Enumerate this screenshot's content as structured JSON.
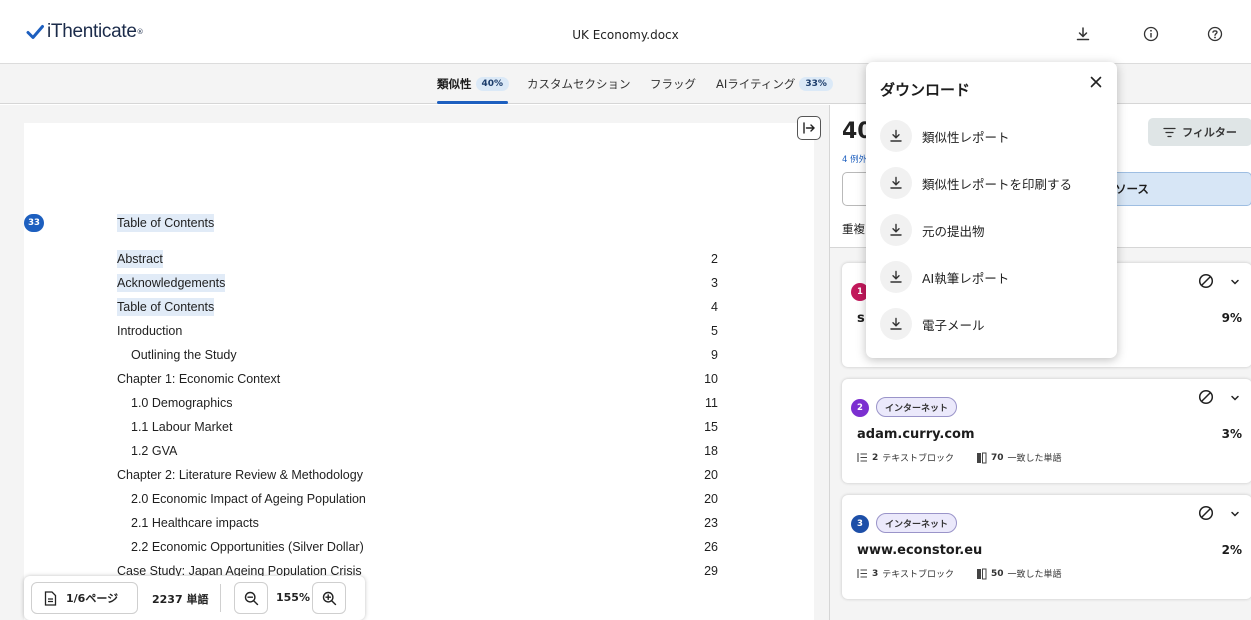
{
  "app": {
    "logo_text": "iThenticate",
    "logo_mark": "®",
    "document_title": "UK Economy.docx"
  },
  "tabs": [
    {
      "label": "類似性",
      "badge": "40%"
    },
    {
      "label": "カスタムセクション"
    },
    {
      "label": "フラッグ"
    },
    {
      "label": "AIライティング",
      "badge": "33%"
    }
  ],
  "document": {
    "match_badge": "33",
    "toc_heading": "Table of Contents",
    "toc": [
      {
        "title": "Abstract",
        "page": "2"
      },
      {
        "title": "Acknowledgements",
        "page": "3"
      },
      {
        "title": "Table of Contents",
        "page": "4"
      },
      {
        "title": "Introduction",
        "page": "5"
      },
      {
        "title": "Outlining the Study",
        "page": "9"
      },
      {
        "title": "Chapter 1: Economic Context",
        "page": "10"
      },
      {
        "title": "1.0 Demographics",
        "page": "11"
      },
      {
        "title": "1.1 Labour Market",
        "page": "15"
      },
      {
        "title": "1.2 GVA",
        "page": "18"
      },
      {
        "title": "Chapter 2: Literature Review & Methodology",
        "page": "20"
      },
      {
        "title": "2.0 Economic Impact of Ageing Population",
        "page": "20"
      },
      {
        "title": "2.1 Healthcare impacts",
        "page": "23"
      },
      {
        "title": "2.2 Economic Opportunities (Silver Dollar)",
        "page": "26"
      },
      {
        "title": "Case Study: Japan Ageing Population Crisis",
        "page": "29"
      }
    ]
  },
  "bottom_bar": {
    "page_indicator": "1/6ページ",
    "word_count": "2237 単語",
    "zoom": "155%"
  },
  "panel": {
    "score": "40",
    "exclusions": "4 例外",
    "filter_label": "フィルター",
    "sources_tab": "ソース",
    "duplicates_label": "重複",
    "sources": [
      {
        "number": "1",
        "color": "#c2185b",
        "tag": "",
        "name": "s",
        "percent": "9%",
        "blocks": "",
        "words": ""
      },
      {
        "number": "2",
        "color": "#7b2fd0",
        "tag": "インターネット",
        "name": "adam.curry.com",
        "percent": "3%",
        "blocks": "2",
        "blocks_label": "テキストブロック",
        "words": "70",
        "words_label": "一致した単語"
      },
      {
        "number": "3",
        "color": "#1d4fa8",
        "tag": "インターネット",
        "name": "www.econstor.eu",
        "percent": "2%",
        "blocks": "3",
        "blocks_label": "テキストブロック",
        "words": "50",
        "words_label": "一致した単語"
      }
    ]
  },
  "download_menu": {
    "title": "ダウンロード",
    "items": [
      {
        "label": "類似性レポート"
      },
      {
        "label": "類似性レポートを印刷する"
      },
      {
        "label": "元の提出物"
      },
      {
        "label": "AI執筆レポート"
      },
      {
        "label": "電子メール"
      }
    ]
  },
  "colors": {
    "accent": "#1d5fbf",
    "highlight": "#e1ebf7"
  }
}
